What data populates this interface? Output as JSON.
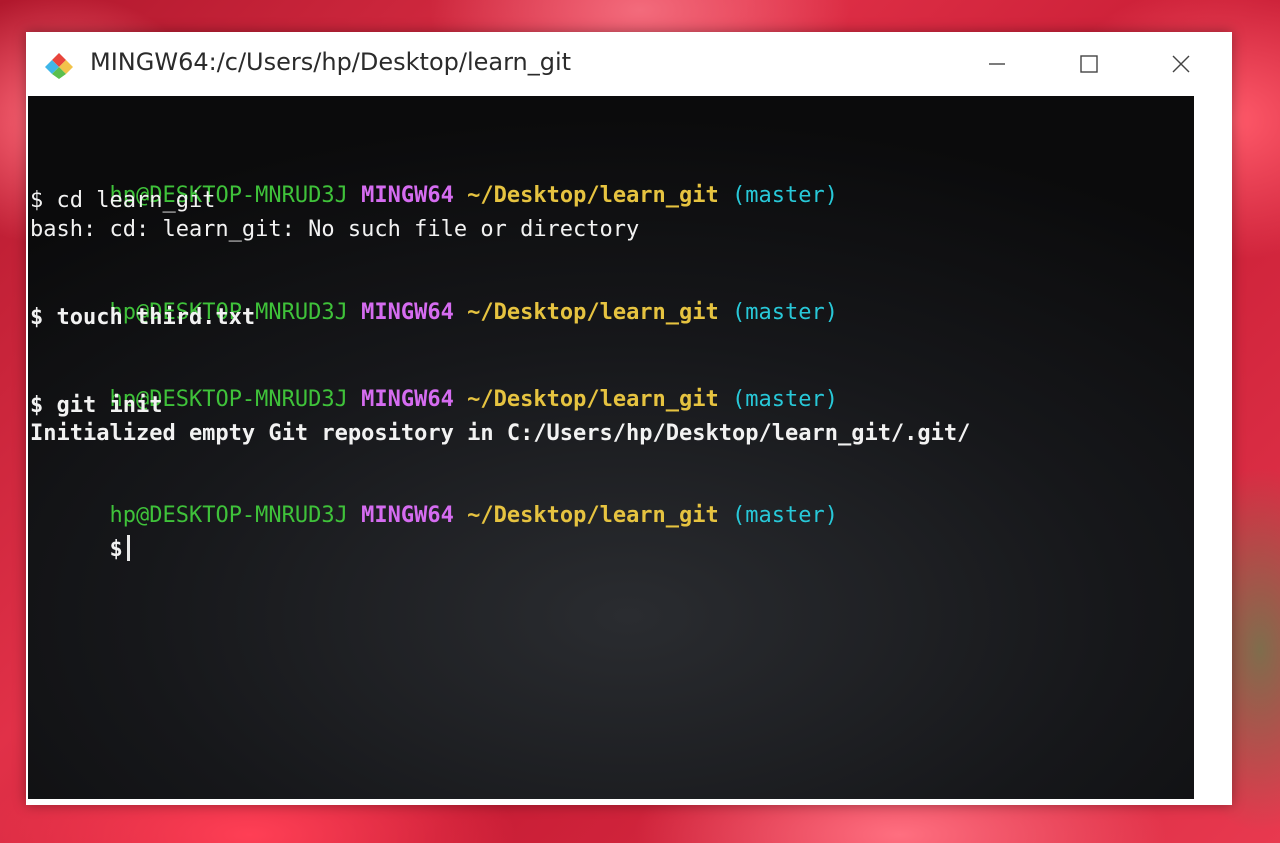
{
  "window": {
    "title": "MINGW64:/c/Users/hp/Desktop/learn_git",
    "icon": "git-bash-icon",
    "controls": {
      "minimize": "minimize-icon",
      "maximize": "maximize-icon",
      "close": "close-icon"
    }
  },
  "terminal": {
    "prompts": [
      {
        "user_host": "hp@DESKTOP-MNRUD3J",
        "system": "MINGW64",
        "path": "~/Desktop/learn_git",
        "branch": "(master)"
      },
      {
        "user_host": "hp@DESKTOP-MNRUD3J",
        "system": "MINGW64",
        "path": "~/Desktop/learn_git",
        "branch": "(master)"
      },
      {
        "user_host": "hp@DESKTOP-MNRUD3J",
        "system": "MINGW64",
        "path": "~/Desktop/learn_git",
        "branch": "(master)"
      },
      {
        "user_host": "hp@DESKTOP-MNRUD3J",
        "system": "MINGW64",
        "path": "~/Desktop/learn_git",
        "branch": "(master)"
      }
    ],
    "commands": [
      "$ cd learn_git",
      "$ touch third.txt",
      "$ git init",
      "$"
    ],
    "outputs": [
      "bash: cd: learn_git: No such file or directory",
      "Initialized empty Git repository in C:/Users/hp/Desktop/learn_git/.git/"
    ]
  },
  "colors": {
    "user_host": "#3fc23a",
    "system": "#d56cf0",
    "path": "#e6c340",
    "branch": "#28c8d8",
    "text": "#f2f2f2",
    "terminal_bg": "#0b0b0c"
  }
}
